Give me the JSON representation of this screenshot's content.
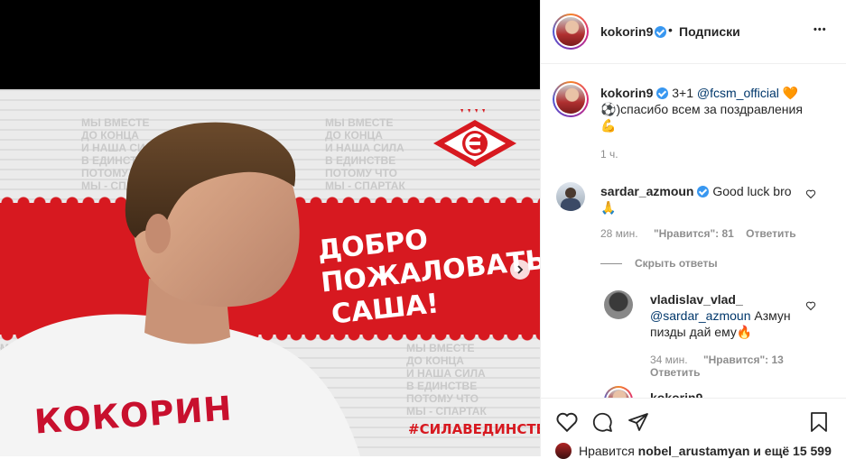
{
  "post": {
    "welcome_lines": [
      "ДОБРО",
      "ПОЖАЛОВАТЬ",
      "САША!"
    ],
    "jersey_name": "КОКОРИН",
    "hashtag": "#СИЛАВЕДИНСТВЕ",
    "wall_text": "МЫ ВМЕСТЕ\nДО КОНЦА\nИ НАША СИЛА\nВ ЕДИНСТВЕ\nПОТОМУ ЧТО\nМЫ - СПАРТАК"
  },
  "header": {
    "username": "kokorin9",
    "separator": "•",
    "follow_label": "Подписки",
    "more_label": "•••"
  },
  "caption": {
    "username": "kokorin9",
    "text_start": "3+1 ",
    "mention": "@fcsm_official",
    "text_rest": "спасибо всем за поздравления",
    "emoji_heart": "🧡",
    "emoji_ball": "⚽",
    "emoji_paren": ")",
    "emoji_muscle": "💪",
    "time": "1 ч."
  },
  "comments": [
    {
      "username": "sardar_azmoun",
      "text": "Good luck bro",
      "emoji": "🙏",
      "time": "28 мин.",
      "likes": "\"Нравится\": 81",
      "reply_label": "Ответить",
      "hide_replies": "Скрыть ответы"
    },
    {
      "username": "vladislav_vlad_",
      "mention": "@sardar_azmoun",
      "text": " Азмун пизды дай ему",
      "emoji": "🔥",
      "time": "34 мин.",
      "likes": "\"Нравится\": 13",
      "reply_label": "Ответить"
    },
    {
      "username": "kokorin9"
    }
  ],
  "likes_line": {
    "prefix": "Нравится ",
    "user": "nobel_arustamyan",
    "suffix": " и ещё 15 599"
  },
  "colors": {
    "brand_red": "#d71920",
    "link": "#00376b",
    "muted": "#8e8e8e",
    "verified": "#3897f0"
  },
  "icons": [
    "heart-icon",
    "comment-icon",
    "share-icon",
    "bookmark-icon",
    "more-icon",
    "chevron-right-icon",
    "verified-icon"
  ]
}
